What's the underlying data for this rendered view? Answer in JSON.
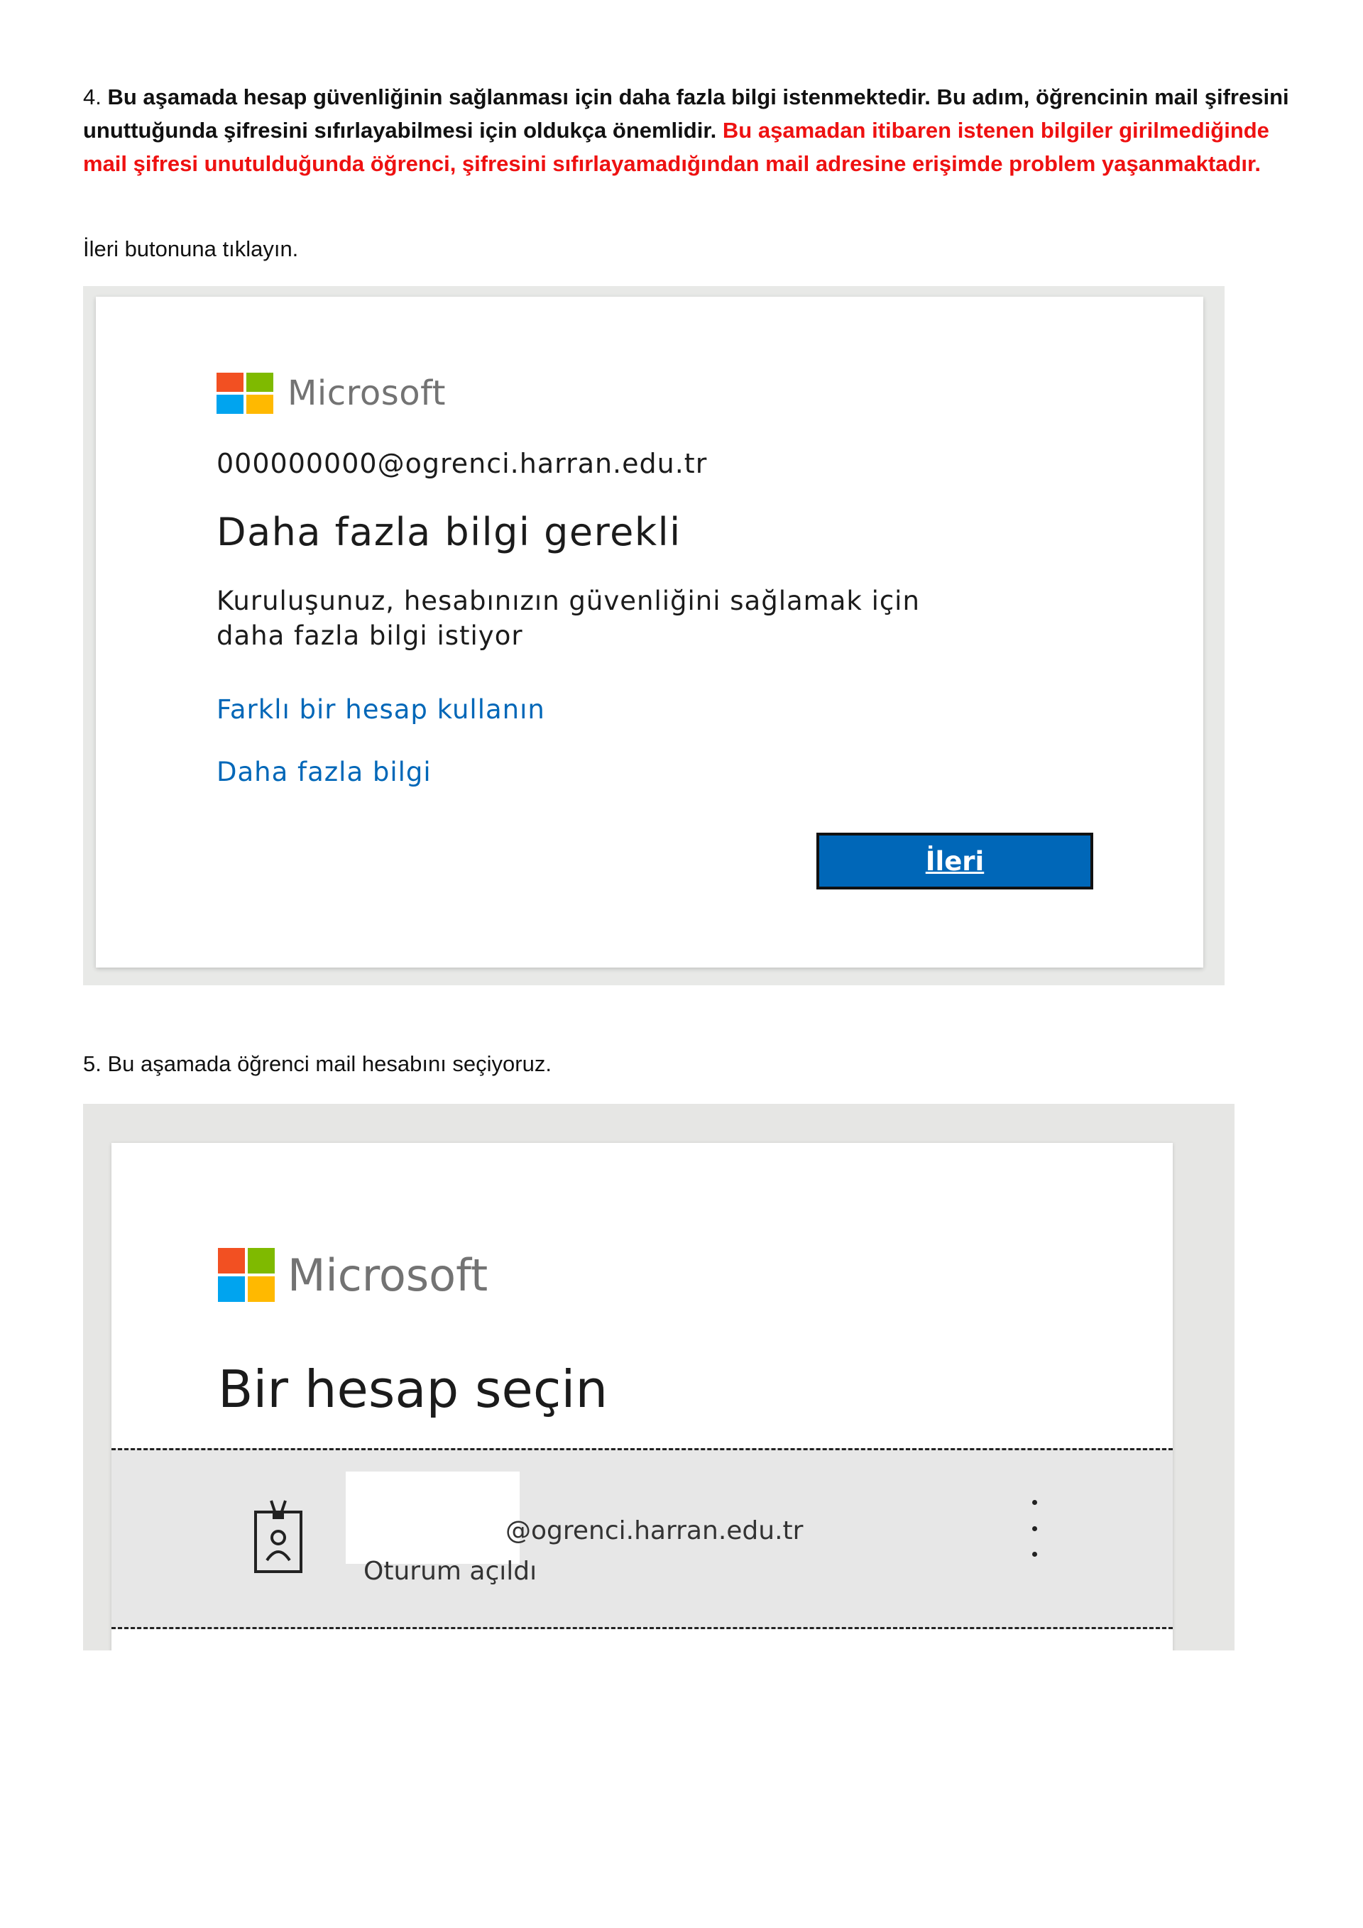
{
  "step4": {
    "number": "4.",
    "bold_text": "Bu aşamada hesap güvenliğinin sağlanması için daha fazla bilgi istenmektedir. Bu adım, öğrencinin mail şifresini unuttuğunda şifresini sıfırlayabilmesi için oldukça önemlidir.",
    "warning_text": "Bu aşamadan itibaren istenen bilgiler girilmediğinde mail şifresi unutulduğunda öğrenci, şifresini sıfırlayamadığından mail adresine erişimde problem yaşanmaktadır.",
    "instruction": "İleri butonuna tıklayın."
  },
  "screenshot1": {
    "brand": "Microsoft",
    "email": "000000000@ogrenci.harran.edu.tr",
    "title": "Daha fazla bilgi gerekli",
    "description_line1": "Kuruluşunuz, hesabınızın güvenliğini sağlamak için",
    "description_line2": "daha fazla bilgi istiyor",
    "link_other_account": "Farklı bir hesap kullanın",
    "link_more_info": "Daha fazla bilgi",
    "next_button": "İleri"
  },
  "step5": {
    "text": "5. Bu aşamada öğrenci mail hesabını seçiyoruz."
  },
  "screenshot2": {
    "brand": "Microsoft",
    "title": "Bir hesap seçin",
    "account_domain": "@ogrenci.harran.edu.tr",
    "account_status": "Oturum açıldı"
  },
  "colors": {
    "ms_red": "#f25022",
    "ms_green": "#7fba00",
    "ms_blue": "#00a4ef",
    "ms_yellow": "#ffb900",
    "link_blue": "#0067b8",
    "warning_red": "#ee1111"
  }
}
